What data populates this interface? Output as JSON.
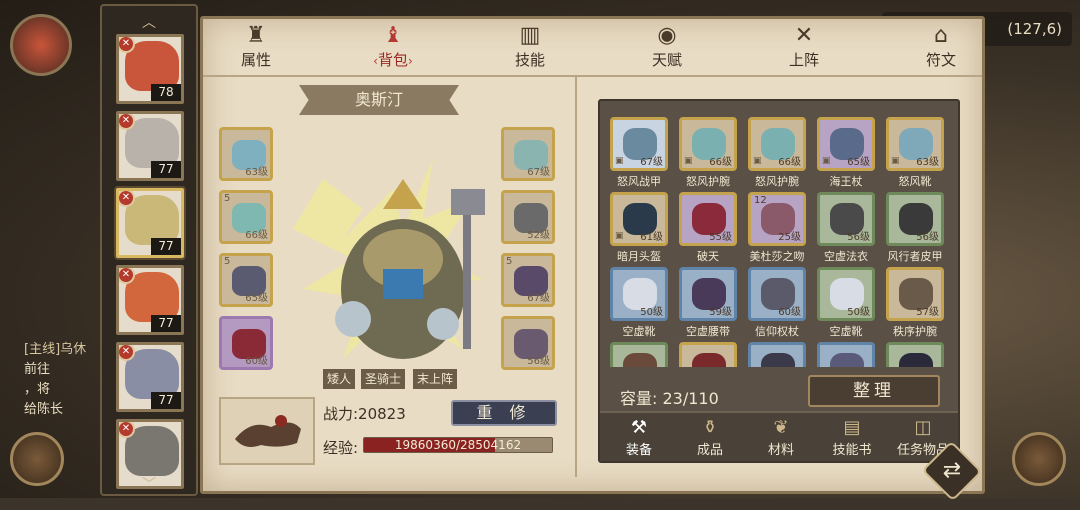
{
  "hud": {
    "coord": "(127,6)"
  },
  "quest": {
    "line1": "[主线]乌休",
    "line2a": "前往",
    "line2b": "",
    "line3a": "",
    "line3b": "，将",
    "line4": "给陈长"
  },
  "tabs": [
    {
      "label": "属性",
      "icon": "figure-icon"
    },
    {
      "label": "背包",
      "icon": "bag-icon",
      "active": true
    },
    {
      "label": "技能",
      "icon": "book-icon"
    },
    {
      "label": "天赋",
      "icon": "eye-icon"
    },
    {
      "label": "上阵",
      "icon": "crossed-swords-icon"
    },
    {
      "label": "符文",
      "icon": "rune-icon"
    }
  ],
  "heroes": [
    {
      "level": "78",
      "color": "#c9553a",
      "tag": "✕"
    },
    {
      "level": "77",
      "color": "#b8b2aa",
      "tag": "✕"
    },
    {
      "level": "77",
      "color": "#c9b878",
      "tag": "✕",
      "selected": true
    },
    {
      "level": "77",
      "color": "#d2663c",
      "tag": "✕"
    },
    {
      "level": "77",
      "color": "#8a8ea4",
      "tag": "✕"
    },
    {
      "level": "",
      "color": "#7a7670",
      "tag": "✕"
    }
  ],
  "hero_name": "奥斯汀",
  "equip_left": [
    {
      "level": "63级",
      "star": "",
      "color": "#7fb0c0"
    },
    {
      "level": "66级",
      "star": "5",
      "color": "#7fb8b0"
    },
    {
      "level": "65级",
      "star": "5",
      "color": "#5a5a70"
    },
    {
      "level": "60级",
      "star": "",
      "color": "#8a2a36",
      "purple": true
    }
  ],
  "equip_right": [
    {
      "level": "67级",
      "star": "",
      "color": "#8ab4b0"
    },
    {
      "level": "52级",
      "star": "",
      "color": "#6a6a6a"
    },
    {
      "level": "67级",
      "star": "5",
      "color": "#5a4a6a"
    },
    {
      "level": "56级",
      "star": "",
      "color": "#6a5a70"
    }
  ],
  "races": [
    "矮人",
    "圣骑士",
    "末上阵"
  ],
  "power": "战力:20823",
  "repair": "重 修",
  "exp_label": "经验:",
  "exp_text": "19860360/28504162",
  "exp_ratio": 0.697,
  "items": [
    {
      "name": "怒风战甲",
      "level": "67级",
      "count": "",
      "lock": true,
      "tone": "ice",
      "color": "#6a8aa0"
    },
    {
      "name": "怒风护腕",
      "level": "66级",
      "count": "",
      "lock": true,
      "tone": "",
      "color": "#7ab0b0"
    },
    {
      "name": "怒风护腕",
      "level": "66级",
      "count": "",
      "lock": true,
      "tone": "",
      "color": "#7ab0b0"
    },
    {
      "name": "海王杖",
      "level": "65级",
      "count": "",
      "lock": true,
      "tone": "purple",
      "color": "#5a6a8a"
    },
    {
      "name": "怒风靴",
      "level": "63级",
      "count": "",
      "lock": true,
      "tone": "",
      "color": "#7fa8b8"
    },
    {
      "name": "暗月头盔",
      "level": "61级",
      "count": "",
      "lock": true,
      "tone": "",
      "color": "#2a3a4a"
    },
    {
      "name": "破天",
      "level": "55级",
      "count": "",
      "lock": false,
      "tone": "purple",
      "color": "#8a2a3a"
    },
    {
      "name": "美杜莎之吻",
      "level": "25级",
      "count": "12",
      "lock": false,
      "tone": "purple",
      "color": "#8a5a6a"
    },
    {
      "name": "空虚法衣",
      "level": "56级",
      "count": "",
      "lock": false,
      "tone": "green",
      "color": "#4a4a4a"
    },
    {
      "name": "风行者皮甲",
      "level": "56级",
      "count": "",
      "lock": false,
      "tone": "green",
      "color": "#3a3a3a"
    },
    {
      "name": "空虚靴",
      "level": "50级",
      "count": "",
      "lock": false,
      "tone": "blue",
      "color": "#d8dce4"
    },
    {
      "name": "空虚腰带",
      "level": "59级",
      "count": "",
      "lock": false,
      "tone": "blue",
      "color": "#4a3a5a"
    },
    {
      "name": "信仰权杖",
      "level": "60级",
      "count": "",
      "lock": false,
      "tone": "blue",
      "color": "#5a5a6a"
    },
    {
      "name": "空虚靴",
      "level": "50级",
      "count": "",
      "lock": false,
      "tone": "green",
      "color": "#d8dce4"
    },
    {
      "name": "秩序护腕",
      "level": "57级",
      "count": "",
      "lock": false,
      "tone": "",
      "color": "#6a5a4a"
    },
    {
      "name": "",
      "level": "",
      "count": "",
      "lock": false,
      "tone": "green",
      "color": "#6a4a3a"
    },
    {
      "name": "",
      "level": "",
      "count": "",
      "lock": false,
      "tone": "",
      "color": "#7a2a2a"
    },
    {
      "name": "",
      "level": "",
      "count": "",
      "lock": false,
      "tone": "blue",
      "color": "#3a3a4a"
    },
    {
      "name": "",
      "level": "",
      "count": "",
      "lock": false,
      "tone": "blue",
      "color": "#5a5a7a"
    },
    {
      "name": "",
      "level": "",
      "count": "",
      "lock": false,
      "tone": "green",
      "color": "#2a2a3a"
    }
  ],
  "capacity": "容量:  23/110",
  "sort_label": "整理",
  "categories": [
    {
      "label": "装备",
      "icon": "hammer-icon",
      "active": true
    },
    {
      "label": "成品",
      "icon": "bottle-icon"
    },
    {
      "label": "材料",
      "icon": "leaf-icon"
    },
    {
      "label": "技能书",
      "icon": "scroll-icon"
    },
    {
      "label": "任务物品",
      "icon": "box-icon"
    }
  ]
}
